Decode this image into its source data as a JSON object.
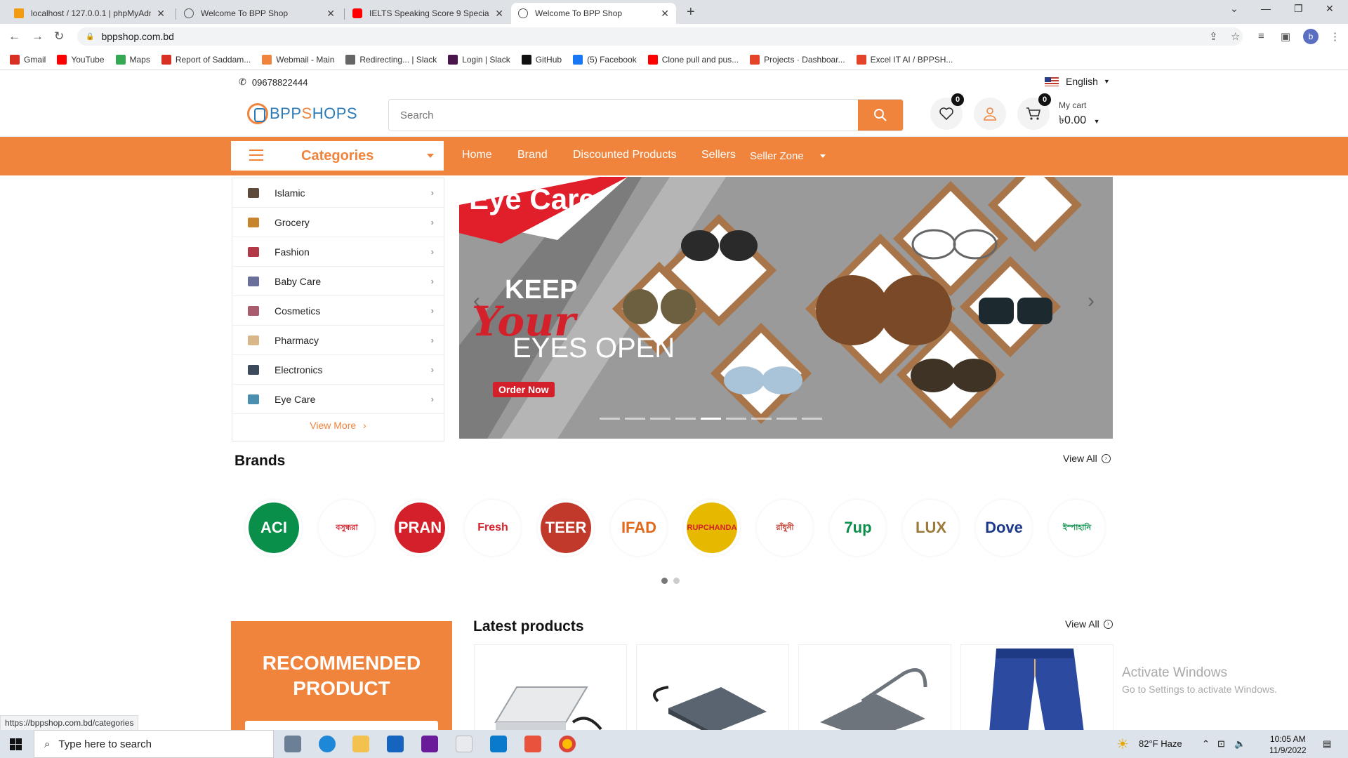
{
  "browser": {
    "tabs": [
      {
        "title": "localhost / 127.0.0.1 | phpMyAdmin",
        "active": false
      },
      {
        "title": "Welcome To BPP Shop",
        "active": false
      },
      {
        "title": "IELTS Speaking Score 9 Special Structures",
        "active": false
      },
      {
        "title": "Welcome To BPP Shop",
        "active": true
      }
    ],
    "url": "bppshop.com.bd",
    "profile_initial": "b",
    "bookmarks": [
      {
        "label": "Gmail",
        "icon": "gmail-icon",
        "color": "#d93025"
      },
      {
        "label": "YouTube",
        "icon": "youtube-icon",
        "color": "#ff0000"
      },
      {
        "label": "Maps",
        "icon": "maps-icon",
        "color": "#34a853"
      },
      {
        "label": "Report of Saddam...",
        "icon": "gmail-icon",
        "color": "#d93025"
      },
      {
        "label": "Webmail - Main",
        "icon": "webmail-icon",
        "color": "#f0843c"
      },
      {
        "label": "Redirecting... | Slack",
        "icon": "globe-icon",
        "color": "#666666"
      },
      {
        "label": "Login | Slack",
        "icon": "slack-icon",
        "color": "#4a154b"
      },
      {
        "label": "GitHub",
        "icon": "github-icon",
        "color": "#111111"
      },
      {
        "label": "(5) Facebook",
        "icon": "facebook-icon",
        "color": "#1877f2"
      },
      {
        "label": "Clone pull and pus...",
        "icon": "youtube-icon",
        "color": "#ff0000"
      },
      {
        "label": "Projects · Dashboar...",
        "icon": "gitlab-icon",
        "color": "#e24329"
      },
      {
        "label": "Excel IT AI / BPPSH...",
        "icon": "gitlab-icon",
        "color": "#e24329"
      }
    ],
    "status_url": "https://bppshop.com.bd/categories"
  },
  "site": {
    "phone": "09678822444",
    "language": "English",
    "logo_text_a": "BPP",
    "logo_text_b": "S",
    "logo_text_c": "HOPS",
    "search_placeholder": "Search",
    "wishlist_count": "0",
    "cart_count": "0",
    "cart_label": "My cart",
    "cart_total": "৳0.00",
    "accent_color": "#f0843c"
  },
  "nav": {
    "categories_label": "Categories",
    "links": [
      "Home",
      "Brand",
      "Discounted Products",
      "Sellers",
      "Seller Zone"
    ]
  },
  "categories": [
    {
      "label": "Islamic",
      "color": "#5d4a3a"
    },
    {
      "label": "Grocery",
      "color": "#c8842c"
    },
    {
      "label": "Fashion",
      "color": "#b23a48"
    },
    {
      "label": "Baby Care",
      "color": "#6b6f9c"
    },
    {
      "label": "Cosmetics",
      "color": "#a85c6c"
    },
    {
      "label": "Pharmacy",
      "color": "#d8b88a"
    },
    {
      "label": "Electronics",
      "color": "#3c4a5c"
    },
    {
      "label": "Eye Care",
      "color": "#4b8fb0"
    }
  ],
  "view_more": "View More",
  "hero": {
    "title": "Eye Care",
    "line1": "KEEP",
    "line2": "Your",
    "line3": "EYES  OPEN",
    "cta": "Order Now",
    "slide_count": 9,
    "active_slide": 4
  },
  "brands": {
    "title": "Brands",
    "view_all": "View All",
    "items": [
      {
        "label": "ACI",
        "color": "#0a8f4a",
        "bg": "#0a8f4a",
        "fg": "#ffffff"
      },
      {
        "label": "বসুন্ধরা",
        "color": "#d4202a",
        "bg": "#ffffff",
        "fg": "#d4202a"
      },
      {
        "label": "PRAN",
        "color": "#d4202a",
        "bg": "#d4202a",
        "fg": "#ffffff"
      },
      {
        "label": "Fresh",
        "color": "#d4202a",
        "bg": "#ffffff",
        "fg": "#d4202a"
      },
      {
        "label": "TEER",
        "color": "#c0392b",
        "bg": "#c0392b",
        "fg": "#ffffff"
      },
      {
        "label": "IFAD",
        "color": "#f0843c",
        "bg": "#ffffff",
        "fg": "#e06a1c"
      },
      {
        "label": "RUPCHANDA",
        "color": "#d4202a",
        "bg": "#e6b800",
        "fg": "#d4202a"
      },
      {
        "label": "রাঁধুনী",
        "color": "#c0392b",
        "bg": "#ffffff",
        "fg": "#c0392b"
      },
      {
        "label": "7up",
        "color": "#0a8f4a",
        "bg": "#ffffff",
        "fg": "#0a8f4a"
      },
      {
        "label": "LUX",
        "color": "#9c7a3c",
        "bg": "#ffffff",
        "fg": "#9c7a3c"
      },
      {
        "label": "Dove",
        "color": "#1d3a8a",
        "bg": "#ffffff",
        "fg": "#1d3a8a"
      },
      {
        "label": "ইস্পাহানি",
        "color": "#0a8f4a",
        "bg": "#ffffff",
        "fg": "#0a8f4a"
      }
    ],
    "pages": 2,
    "active_page": 0
  },
  "recommended": {
    "label_1": "RECOMMENDED",
    "label_2": "PRODUCT"
  },
  "latest": {
    "title": "Latest products",
    "view_all": "View All"
  },
  "watermark": {
    "line1": "Activate Windows",
    "line2": "Go to Settings to activate Windows."
  },
  "taskbar": {
    "search_placeholder": "Type here to search",
    "weather": "82°F  Haze",
    "time": "10:05 AM",
    "date": "11/9/2022"
  }
}
